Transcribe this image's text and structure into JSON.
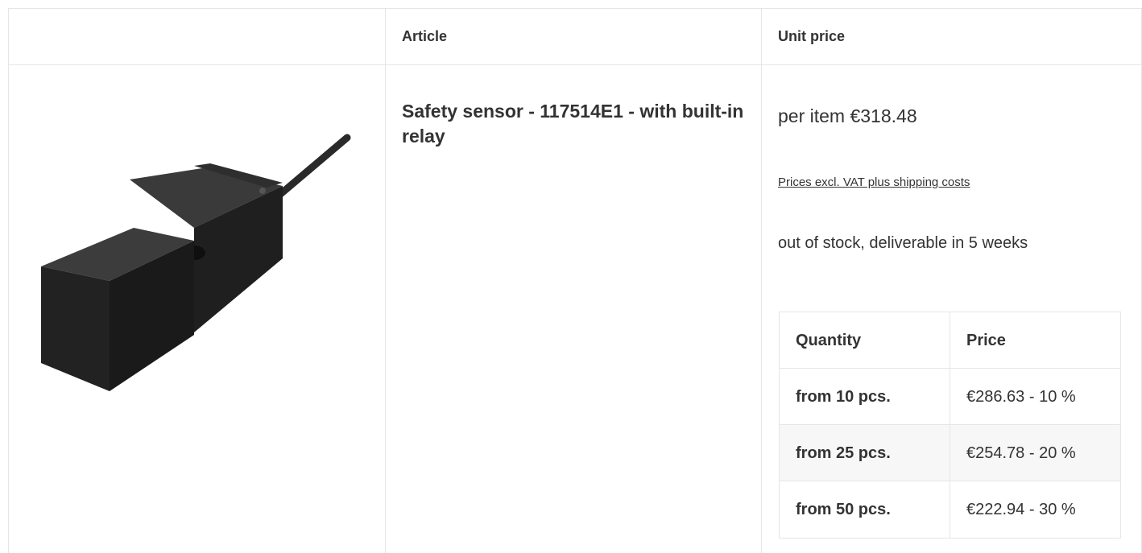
{
  "table": {
    "headers": {
      "image": "",
      "article": "Article",
      "unit_price": "Unit price"
    }
  },
  "product": {
    "title": "Safety sensor - 117514E1 - with built-in relay",
    "image_icon": "sensor-product-image",
    "price_line": "per item €318.48",
    "vat_note": "Prices excl. VAT plus shipping costs",
    "stock": "out of stock, deliverable in 5 weeks"
  },
  "tiers": {
    "header": {
      "quantity": "Quantity",
      "price": "Price"
    },
    "rows": [
      {
        "quantity": "from 10 pcs.",
        "price": "€286.63 - 10 %"
      },
      {
        "quantity": "from 25 pcs.",
        "price": "€254.78 - 20 %"
      },
      {
        "quantity": "from 50 pcs.",
        "price": "€222.94 - 30 %"
      }
    ]
  }
}
